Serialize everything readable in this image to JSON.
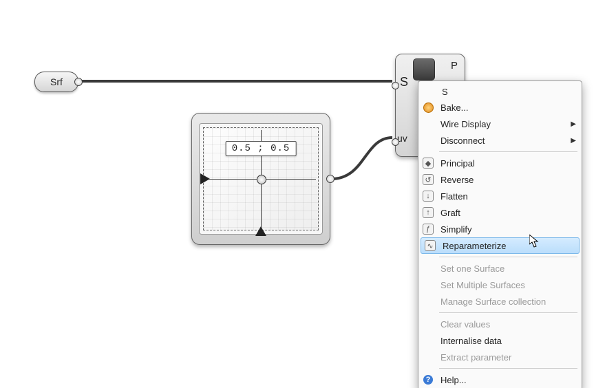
{
  "param": {
    "label": "Srf"
  },
  "md_slider": {
    "value_text": "0.5 ; 0.5"
  },
  "component": {
    "input_s": "S",
    "input_uv": "uv",
    "output_p": "P"
  },
  "menu": {
    "title": "S",
    "bake": "Bake...",
    "wire_display": "Wire Display",
    "disconnect": "Disconnect",
    "principal": "Principal",
    "reverse": "Reverse",
    "flatten": "Flatten",
    "graft": "Graft",
    "simplify": "Simplify",
    "reparameterize": "Reparameterize",
    "set_one": "Set one Surface",
    "set_multiple": "Set Multiple Surfaces",
    "manage_collection": "Manage Surface collection",
    "clear": "Clear values",
    "internalise": "Internalise data",
    "extract": "Extract parameter",
    "help": "Help..."
  }
}
